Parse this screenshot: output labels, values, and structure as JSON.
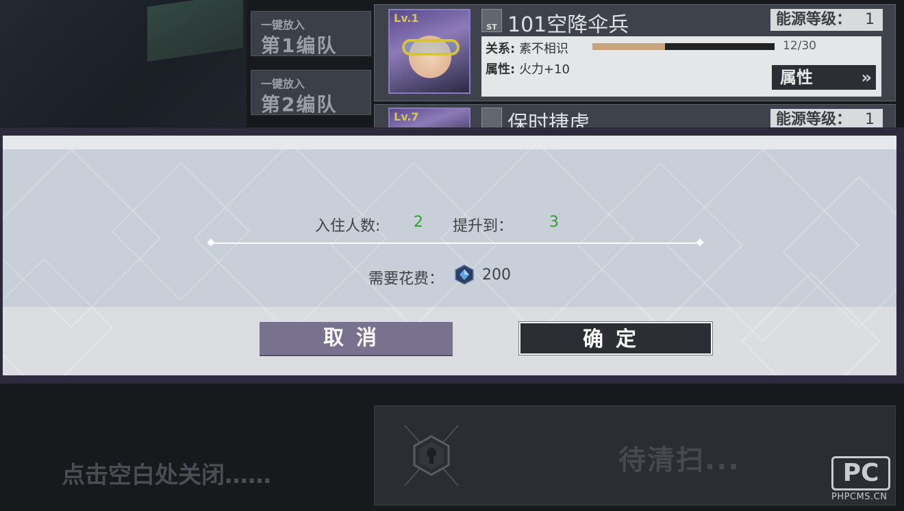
{
  "teams": [
    {
      "small": "一键放入",
      "big": "第1编队"
    },
    {
      "small": "一键放入",
      "big": "第2编队"
    }
  ],
  "cards": [
    {
      "level": "Lv.1",
      "type_tag": "ST",
      "name": "101空降伞兵",
      "energy_label": "能源等级：",
      "energy_value": "1",
      "relation_label": "关系:",
      "relation_value": "素不相识",
      "progress_text": "12/30",
      "progress_fraction": 0.4,
      "attr_label": "属性:",
      "attr_value": "火力+10",
      "attr_button": "属性"
    },
    {
      "level": "Lv.7",
      "name": "保时捷虎",
      "energy_label": "能源等级：",
      "energy_value": "1"
    }
  ],
  "modal": {
    "residents_label": "入住人数:",
    "residents_value": "2",
    "upgrade_label": "提升到：",
    "upgrade_value": "3",
    "cost_label": "需要花费：",
    "cost_value": "200",
    "cost_icon": "gem-icon",
    "cancel_label": "取消",
    "confirm_label": "确定"
  },
  "empty_slot": {
    "pending_text": "待清扫..."
  },
  "close_hint": "点击空白处关闭……",
  "watermark": {
    "mark": "PC",
    "site": "PHPCMS.CN"
  },
  "colors": {
    "accent_green": "#2ea02e",
    "cancel_button": "#79728f",
    "confirm_button": "#2d2e33",
    "overlay": "#2c2a3c"
  }
}
